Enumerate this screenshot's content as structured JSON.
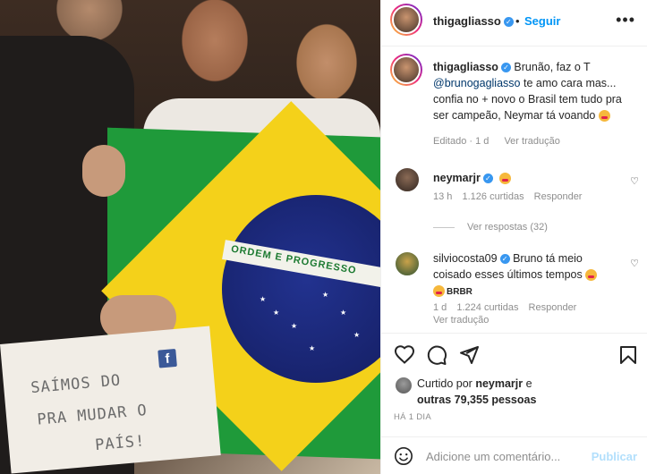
{
  "post_image": {
    "band_text": "ORDEM E PROGRESSO",
    "sign_line1": "SAÍMOS DO",
    "sign_line2": "PRA MUDAR O",
    "sign_line3": "PAÍS!",
    "sign_logo": "f"
  },
  "header": {
    "username": "thigagliasso",
    "follow_label": "Seguir",
    "more_icon": "more-horizontal-icon"
  },
  "caption": {
    "username": "thigagliasso",
    "text_before": "Brunão, faz o T",
    "mention": "@brunogagliasso",
    "text_after": "te amo cara mas... confia no + novo o Brasil tem tudo pra ser campeão, Neymar tá voando",
    "edited": "Editado",
    "age": "1 d",
    "translate": "Ver tradução"
  },
  "comments": [
    {
      "username": "neymarjr",
      "text": "",
      "age": "13 h",
      "likes": "1.126 curtidas",
      "reply": "Responder"
    },
    {
      "username": "silviocosta09",
      "text": "Bruno tá meio coisado esses últimos tempos",
      "extra": "BRBR",
      "age": "1 d",
      "likes": "1.224 curtidas",
      "reply": "Responder",
      "translate": "Ver tradução"
    }
  ],
  "view_replies": "Ver respostas (32)",
  "likes_line": {
    "prefix": "Curtido por",
    "user": "neymarjr",
    "middle": "e",
    "others": "outras 79,355 pessoas"
  },
  "timestamp": "HÁ 1 DIA",
  "add_comment": {
    "placeholder": "Adicione um comentário...",
    "publish_label": "Publicar"
  },
  "colors": {
    "link_blue": "#0095f6",
    "verified_blue": "#3897f0",
    "muted": "#8e8e8e",
    "publish_disabled": "#b2dffc"
  }
}
